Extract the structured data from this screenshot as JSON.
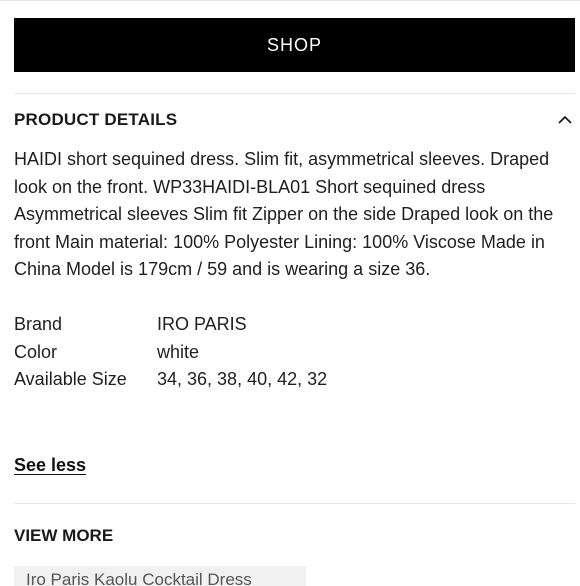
{
  "shop_button": {
    "label": "SHOP"
  },
  "product_details": {
    "title": "PRODUCT DETAILS",
    "description": "HAIDI short sequined dress. Slim fit, asymmetrical sleeves. Draped look on the front. WP33HAIDI-BLA01 Short sequined dress Asymmetrical sleeves Slim fit Zipper on the side Draped look on the front Main material: 100% Polyester Lining: 100% Viscose Made in China Model is 179cm / 59 and is wearing a size 36.",
    "specs": [
      {
        "label": "Brand",
        "value": "IRO PARIS"
      },
      {
        "label": "Color",
        "value": "white"
      },
      {
        "label": "Available Size",
        "value": "34, 36, 38, 40, 42, 32"
      }
    ],
    "see_less": "See less"
  },
  "view_more": {
    "title": "VIEW MORE",
    "card_text": "Iro Paris Kaolu Cocktail Dress"
  },
  "icons": {
    "collapse": "chevron-up-icon"
  }
}
